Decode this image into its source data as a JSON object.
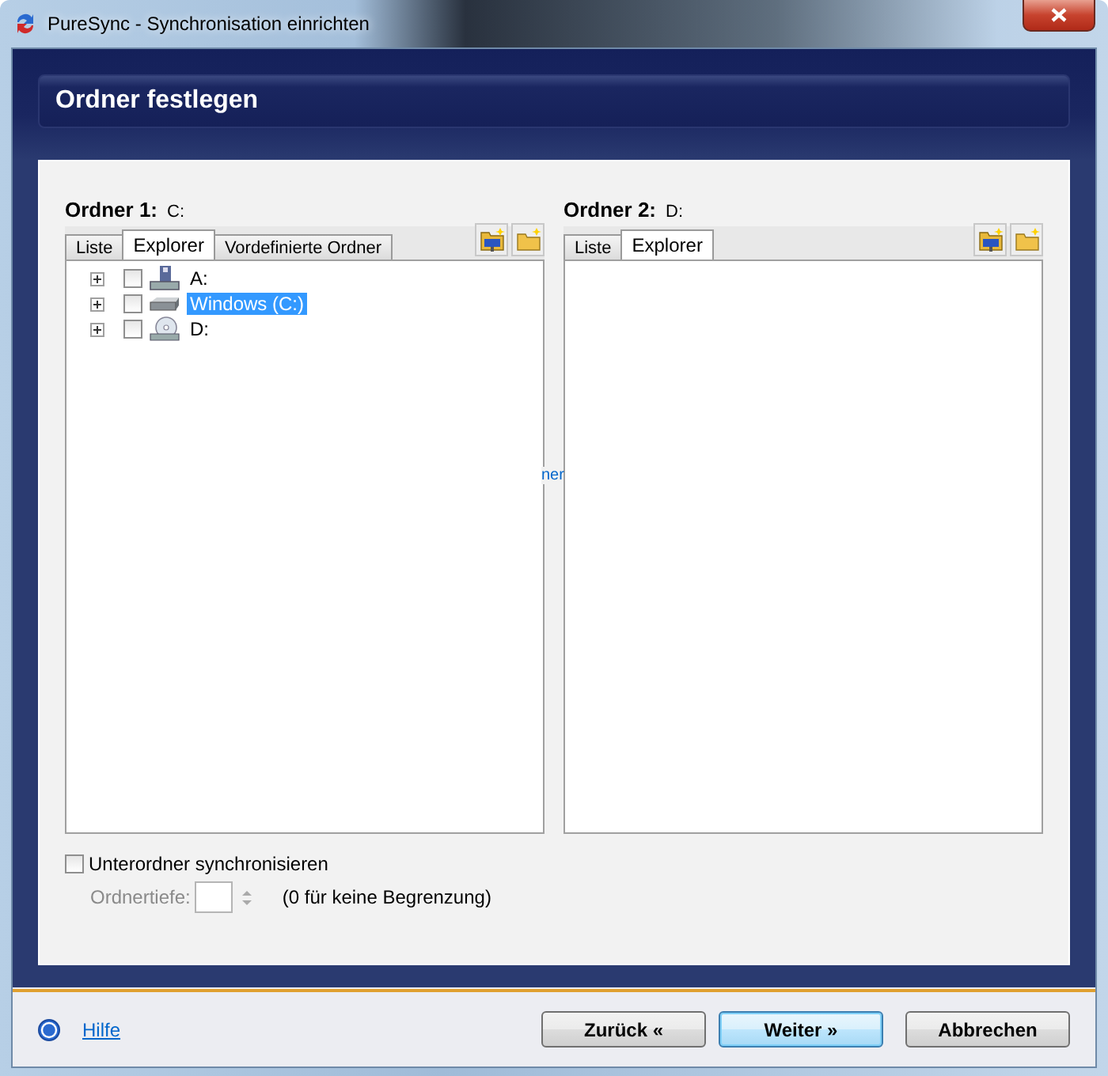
{
  "window": {
    "title": "PureSync - Synchronisation einrichten"
  },
  "header": {
    "title": "Ordner festlegen"
  },
  "panes": [
    {
      "label": "Ordner 1:",
      "path": "C:",
      "tabs": [
        {
          "label": "Liste",
          "selected": false
        },
        {
          "label": "Explorer",
          "selected": true
        },
        {
          "label": "Vordefinierte Ordner",
          "selected": false
        }
      ],
      "tree": [
        {
          "label": "A:",
          "kind": "floppy",
          "checked": false,
          "selected": false,
          "expanded": false
        },
        {
          "label": "Windows (C:)",
          "kind": "disk",
          "checked": false,
          "selected": true,
          "expanded": false
        },
        {
          "label": "D:",
          "kind": "cdrom",
          "checked": false,
          "selected": false,
          "expanded": false
        }
      ]
    },
    {
      "label": "Ordner 2:",
      "path": "D:",
      "tabs": [
        {
          "label": "Liste",
          "selected": false
        },
        {
          "label": "Explorer",
          "selected": true
        }
      ]
    }
  ],
  "clipped_link": "ner",
  "options": {
    "subfolders": {
      "label": "Unterordner synchronisieren",
      "checked": false
    },
    "depth": {
      "label": "Ordnertiefe:",
      "disabled": true,
      "hint": "(0 für keine Begrenzung)"
    }
  },
  "help": {
    "label": "Hilfe"
  },
  "buttons": [
    {
      "label": "Zurück «",
      "default": false
    },
    {
      "label": "Weiter »",
      "default": true
    },
    {
      "label": "Abbrechen",
      "default": false
    }
  ]
}
